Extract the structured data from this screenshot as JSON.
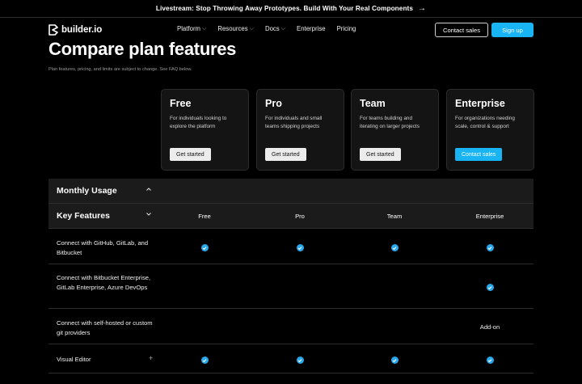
{
  "banner": {
    "text": "Livestream: Stop Throwing Away Prototypes. Build With Your Real Components",
    "arrow": "→"
  },
  "nav": {
    "logo_text": "builder.io",
    "menu": [
      {
        "label": "Platform",
        "has_dropdown": true
      },
      {
        "label": "Resources",
        "has_dropdown": true
      },
      {
        "label": "Docs",
        "has_dropdown": true
      },
      {
        "label": "Enterprise",
        "has_dropdown": false
      },
      {
        "label": "Pricing",
        "has_dropdown": false
      }
    ],
    "contact_label": "Contact sales",
    "signup_label": "Sign up"
  },
  "page": {
    "title": "Compare plan features",
    "subtitle": "Plan features, pricing, and limits are subject to change. See FAQ below."
  },
  "plans": [
    {
      "name": "Free",
      "description": "For individuals looking to explore the platform",
      "button": "Get started",
      "primary": false
    },
    {
      "name": "Pro",
      "description": "For individuals and small teams shipping projects",
      "button": "Get started",
      "primary": false
    },
    {
      "name": "Team",
      "description": "For teams building and iterating on larger projects",
      "button": "Get started",
      "primary": false
    },
    {
      "name": "Enterprise",
      "description": "For organizations needing scale, control & support",
      "button": "Contact sales",
      "primary": true
    }
  ],
  "table": {
    "monthly_usage": "Monthly Usage",
    "key_features": "Key Features",
    "columns": [
      "Free",
      "Pro",
      "Team",
      "Enterprise"
    ],
    "rows": [
      {
        "label": "Connect with GitHub, GitLab, and Bitbucket",
        "cells": [
          "check",
          "check",
          "check",
          "check"
        ],
        "expandable": false
      },
      {
        "label": "Connect with Bitbucket Enterprise, GitLab Enterprise, Azure DevOps",
        "cells": [
          "",
          "",
          "",
          "check"
        ],
        "expandable": false
      },
      {
        "label": "Connect with self-hosted or custom git providers",
        "cells": [
          "",
          "",
          "",
          "Add-on"
        ],
        "expandable": false
      },
      {
        "label": "Visual Editor",
        "cells": [
          "check",
          "check",
          "check",
          "check"
        ],
        "expandable": true
      }
    ]
  },
  "colors": {
    "accent": "#18b4f4",
    "check": "#29a8ee",
    "card_bg": "#141414",
    "section_bg": "#1b1b1b"
  },
  "icons": {
    "section_collapse": "chevron-up-icon",
    "section_expand": "chevron-down-icon",
    "check": "check-circle-icon",
    "expand_row": "plus-icon"
  }
}
